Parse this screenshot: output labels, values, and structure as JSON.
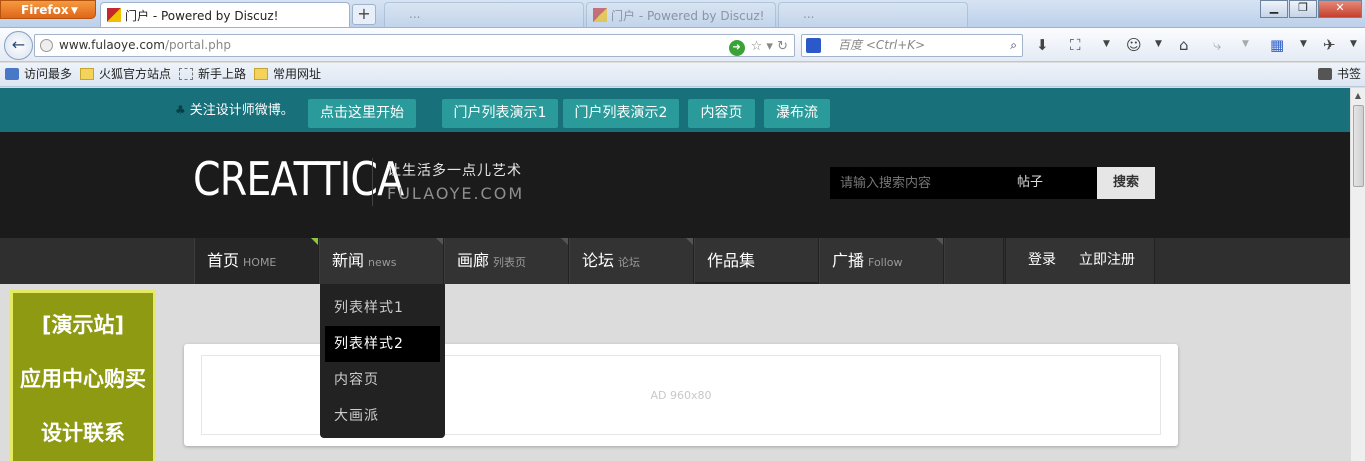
{
  "browser": {
    "app_menu": "Firefox",
    "active_tab_title": "门户 - Powered by Discuz!",
    "inactive_tabs": [
      "...",
      "门户 - Powered by Discuz!",
      "..."
    ],
    "url_domain": "www.fulaoye.com",
    "url_path": "/portal.php",
    "search_placeholder": "百度 <Ctrl+K>",
    "bookmarks": [
      "访问最多",
      "火狐官方站点",
      "新手上路",
      "常用网址"
    ],
    "bookmarks_menu": "书签"
  },
  "topbar": {
    "follow_text": "关注设计师微博。",
    "buttons": [
      "点击这里开始",
      "门户列表演示1",
      "门户列表演示2",
      "内容页",
      "瀑布流"
    ]
  },
  "header": {
    "logo": "CREATTICA",
    "slogan": "让生活多一点儿艺术",
    "domain": "FULAOYE.COM",
    "search_placeholder": "请输入搜索内容",
    "search_type": "帖子",
    "search_button": "搜索"
  },
  "nav": {
    "items": [
      {
        "label": "首页",
        "sub": "HOME"
      },
      {
        "label": "新闻",
        "sub": "news"
      },
      {
        "label": "画廊",
        "sub": "列表页"
      },
      {
        "label": "论坛",
        "sub": "论坛"
      },
      {
        "label": "作品集",
        "sub": ""
      },
      {
        "label": "广播",
        "sub": "Follow"
      }
    ],
    "login": "登录",
    "register": "立即注册"
  },
  "dropdown": {
    "items": [
      "列表样式1",
      "列表样式2",
      "内容页",
      "大画派"
    ],
    "active_index": 1
  },
  "side_ad": [
    "[演示站]",
    "应用中心购买",
    "设计联系"
  ],
  "content": {
    "ad_placeholder": "AD 960x80"
  },
  "colors": {
    "topbar_bg": "#17707a",
    "topbar_button": "#2b9a9a",
    "header_bg": "#1b1b1b",
    "nav_accent": "#8cc63f",
    "side_ad_bg": "#8f9a13"
  }
}
